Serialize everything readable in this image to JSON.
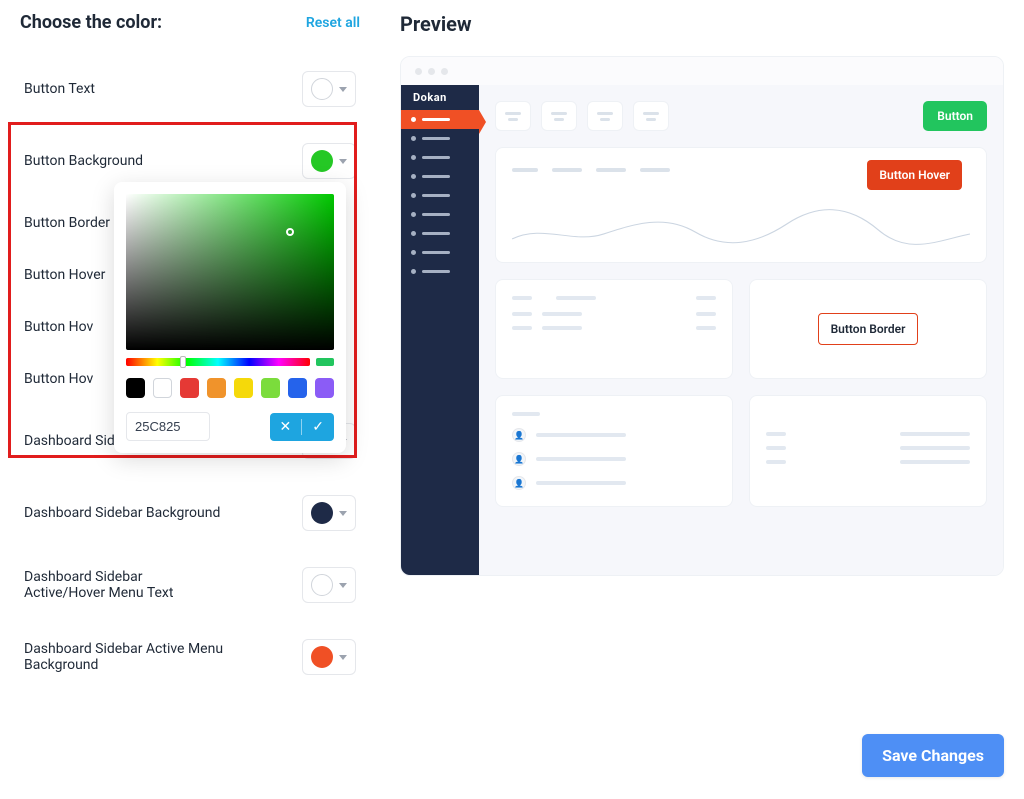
{
  "header": {
    "title": "Choose the color:",
    "reset": "Reset all"
  },
  "left": [
    {
      "label": "Button Text",
      "color": "#ffffff",
      "bordered": true
    },
    {
      "label": "Button Background",
      "color": "#25c825",
      "bordered": false
    },
    {
      "label": "Button Border",
      "color": "",
      "bordered": false
    },
    {
      "label": "Button Hover",
      "color": "",
      "bordered": false
    },
    {
      "label": "Button Hov",
      "color": "",
      "bordered": false
    },
    {
      "label": "Button Hov",
      "color": "",
      "bordered": false
    },
    {
      "label": "Dashboard Sidebar Menu Text",
      "color": "#cfcfcf",
      "bordered": false
    },
    {
      "label": "Dashboard Sidebar Background",
      "color": "#1e2a47",
      "bordered": false
    },
    {
      "label": "Dashboard Sidebar Active/Hover Menu Text",
      "color": "#ffffff",
      "bordered": true
    },
    {
      "label": "Dashboard Sidebar Active Menu Background",
      "color": "#f05025",
      "bordered": false
    }
  ],
  "picker": {
    "hex": "25C825",
    "palette": [
      "#000000",
      "#ffffff",
      "#e53935",
      "#f0932b",
      "#f5d90a",
      "#7bdc3c",
      "#2563eb",
      "#8b5cf6"
    ]
  },
  "preview": {
    "title": "Preview",
    "brand": "Dokan",
    "button_label": "Button",
    "button_hover_label": "Button Hover",
    "button_border_label": "Button Border"
  },
  "footer": {
    "save": "Save Changes"
  }
}
